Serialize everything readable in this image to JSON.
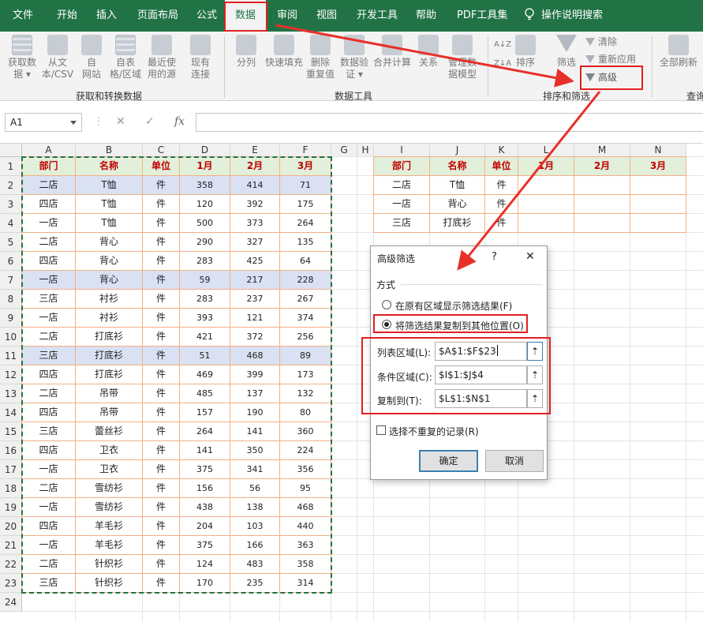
{
  "ribbon_tabs": [
    {
      "label": "文件"
    },
    {
      "label": "开始"
    },
    {
      "label": "插入"
    },
    {
      "label": "页面布局"
    },
    {
      "label": "公式"
    },
    {
      "label": "数据"
    },
    {
      "label": "审阅"
    },
    {
      "label": "视图"
    },
    {
      "label": "开发工具"
    },
    {
      "label": "帮助"
    },
    {
      "label": "PDF工具集"
    }
  ],
  "tell_me": {
    "label": "操作说明搜索",
    "icon": "lightbulb-icon"
  },
  "ribbon": {
    "get_data": {
      "l1": "获取数",
      "l2": "据"
    },
    "from_csv": {
      "l1": "从文",
      "l2": "本/CSV"
    },
    "from_web": {
      "l1": "自",
      "l2": "网站"
    },
    "from_table": {
      "l1": "自表",
      "l2": "格/区域"
    },
    "recent_sources": {
      "l1": "最近使",
      "l2": "用的源"
    },
    "existing_conn": {
      "l1": "现有",
      "l2": "连接"
    },
    "group_get": "获取和转换数据",
    "split": "分列",
    "flash_fill": "快速填充",
    "remove_dup": {
      "l1": "删除",
      "l2": "重复值"
    },
    "data_validation": {
      "l1": "数据验",
      "l2": "证"
    },
    "consolidate": "合并计算",
    "relationships": "关系",
    "data_model": {
      "l1": "管理数",
      "l2": "据模型"
    },
    "group_tools": "数据工具",
    "sort_az": "A↓Z",
    "sort_za": "Z↓A",
    "sort": "排序",
    "filter": "筛选",
    "clear": "清除",
    "reapply": "重新应用",
    "advanced": "高级",
    "group_sort": "排序和筛选",
    "refresh_all": "全部刷新",
    "group_query": "查询"
  },
  "formula_bar": {
    "name_box": "A1",
    "cancel": "✕",
    "enter": "✓",
    "fx": "fx",
    "formula": ""
  },
  "columns": [
    "A",
    "B",
    "C",
    "D",
    "E",
    "F",
    "G",
    "H",
    "I",
    "J",
    "K",
    "L",
    "M",
    "N"
  ],
  "rows": [
    "1",
    "2",
    "3",
    "4",
    "5",
    "6",
    "7",
    "8",
    "9",
    "10",
    "11",
    "12",
    "13",
    "14",
    "15",
    "16",
    "17",
    "18",
    "19",
    "20",
    "21",
    "22",
    "23",
    "24"
  ],
  "source_table": {
    "headers": [
      "部门",
      "名称",
      "单位",
      "1月",
      "2月",
      "3月"
    ],
    "rows": [
      [
        "二店",
        "T恤",
        "件",
        "358",
        "414",
        "71"
      ],
      [
        "四店",
        "T恤",
        "件",
        "120",
        "392",
        "175"
      ],
      [
        "一店",
        "T恤",
        "件",
        "500",
        "373",
        "264"
      ],
      [
        "二店",
        "背心",
        "件",
        "290",
        "327",
        "135"
      ],
      [
        "四店",
        "背心",
        "件",
        "283",
        "425",
        "64"
      ],
      [
        "一店",
        "背心",
        "件",
        "59",
        "217",
        "228"
      ],
      [
        "三店",
        "衬衫",
        "件",
        "283",
        "237",
        "267"
      ],
      [
        "一店",
        "衬衫",
        "件",
        "393",
        "121",
        "374"
      ],
      [
        "二店",
        "打底衫",
        "件",
        "421",
        "372",
        "256"
      ],
      [
        "三店",
        "打底衫",
        "件",
        "51",
        "468",
        "89"
      ],
      [
        "四店",
        "打底衫",
        "件",
        "469",
        "399",
        "173"
      ],
      [
        "二店",
        "吊带",
        "件",
        "485",
        "137",
        "132"
      ],
      [
        "四店",
        "吊带",
        "件",
        "157",
        "190",
        "80"
      ],
      [
        "三店",
        "蕾丝衫",
        "件",
        "264",
        "141",
        "360"
      ],
      [
        "四店",
        "卫衣",
        "件",
        "141",
        "350",
        "224"
      ],
      [
        "一店",
        "卫衣",
        "件",
        "375",
        "341",
        "356"
      ],
      [
        "二店",
        "雪纺衫",
        "件",
        "156",
        "56",
        "95"
      ],
      [
        "一店",
        "雪纺衫",
        "件",
        "438",
        "138",
        "468"
      ],
      [
        "四店",
        "羊毛衫",
        "件",
        "204",
        "103",
        "440"
      ],
      [
        "一店",
        "羊毛衫",
        "件",
        "375",
        "166",
        "363"
      ],
      [
        "二店",
        "针织衫",
        "件",
        "124",
        "483",
        "358"
      ],
      [
        "三店",
        "针织衫",
        "件",
        "170",
        "235",
        "314"
      ]
    ],
    "highlighted_rows": [
      0,
      5,
      9
    ],
    "highlight_color": "#d9e1f2"
  },
  "criteria_table": {
    "headers": [
      "部门",
      "名称",
      "单位"
    ],
    "rows": [
      [
        "二店",
        "T恤",
        "件"
      ],
      [
        "一店",
        "背心",
        "件"
      ],
      [
        "三店",
        "打底衫",
        "件"
      ]
    ]
  },
  "output_table": {
    "headers": [
      "1月",
      "2月",
      "3月"
    ]
  },
  "dialog": {
    "title": "高级筛选",
    "help": "?",
    "close": "✕",
    "section": "方式",
    "opt1": "在原有区域显示筛选结果(F)",
    "opt2": "将筛选结果复制到其他位置(O)",
    "list_label": "列表区域(L):",
    "list_value": "$A$1:$F$23",
    "criteria_label": "条件区域(C):",
    "criteria_value": "$I$1:$J$4",
    "copy_label": "复制到(T):",
    "copy_value": "$L$1:$N$1",
    "unique_label": "选择不重复的记录(R)",
    "ok": "确定",
    "cancel": "取消"
  },
  "colors": {
    "excel_green": "#217346",
    "header_fill": "#e2efda",
    "header_text": "#c00000",
    "annotation": "#e02020",
    "table_border": "#f4b084"
  }
}
